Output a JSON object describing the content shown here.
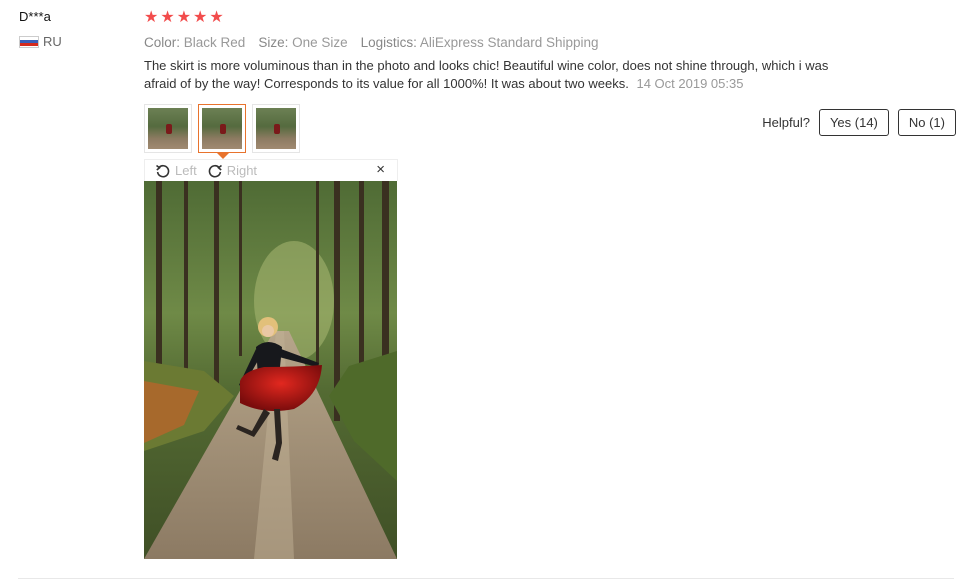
{
  "user": {
    "name": "D***a",
    "country": "RU"
  },
  "rating": {
    "stars": 5
  },
  "meta": {
    "color_label": "Color:",
    "color_value": "Black Red",
    "size_label": "Size:",
    "size_value": "One Size",
    "logistics_label": "Logistics:",
    "logistics_value": "AliExpress Standard Shipping"
  },
  "review": {
    "text": "The skirt is more voluminous than in the photo and looks chic! Beautiful wine color, does not shine through, which i was afraid of by the way! Corresponds to its value for all 1000%! It was about two weeks.",
    "date": "14 Oct 2019 05:35"
  },
  "helpful": {
    "label": "Helpful?",
    "yes_label": "Yes (14)",
    "no_label": "No (1)"
  },
  "viewer": {
    "left_label": "Left",
    "right_label": "Right",
    "close_glyph": "×"
  },
  "colors": {
    "star": "#f24c4c",
    "accent": "#e8732d"
  }
}
